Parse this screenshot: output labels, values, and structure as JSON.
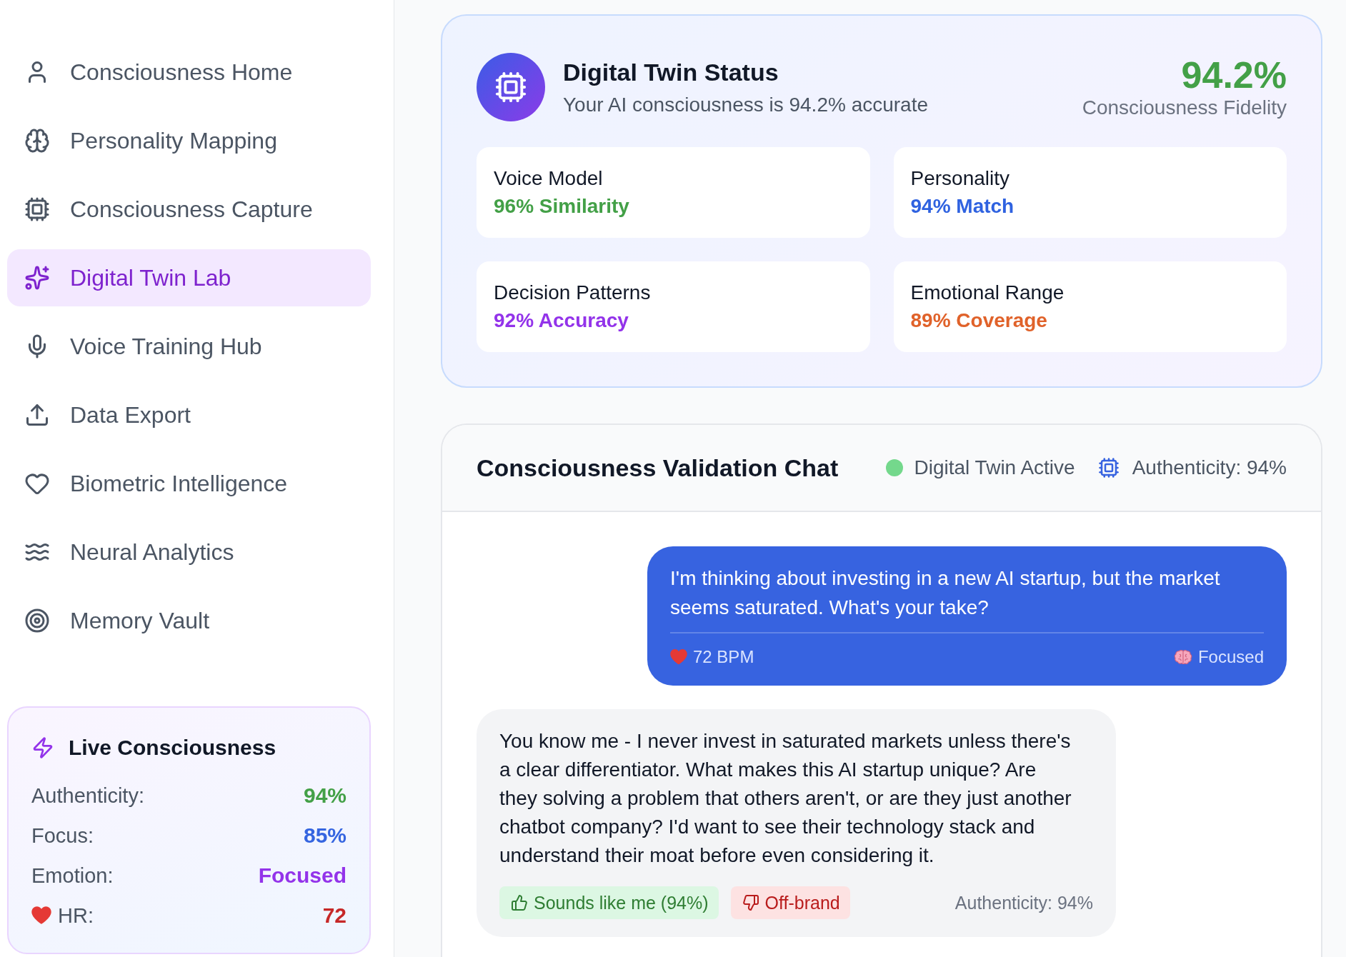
{
  "sidebar": {
    "nav_items": [
      {
        "label": "Consciousness Home",
        "selected": false
      },
      {
        "label": "Personality Mapping",
        "selected": false
      },
      {
        "label": "Consciousness Capture",
        "selected": false
      },
      {
        "label": "Digital Twin Lab",
        "selected": true
      },
      {
        "label": "Voice Training Hub",
        "selected": false
      },
      {
        "label": "Data Export",
        "selected": false
      },
      {
        "label": "Biometric Intelligence",
        "selected": false
      },
      {
        "label": "Neural Analytics",
        "selected": false
      },
      {
        "label": "Memory Vault",
        "selected": false
      }
    ],
    "live_panel": {
      "title": "Live Consciousness",
      "stats": [
        {
          "kind": "plain",
          "label": "Authenticity:",
          "value": "94%",
          "color": "#43a047"
        },
        {
          "kind": "plain",
          "label": "Focus:",
          "value": "85%",
          "color": "#3565e0"
        },
        {
          "kind": "plain",
          "label": "Emotion:",
          "value": "Focused",
          "color": "#9333ea"
        },
        {
          "kind": "vital",
          "label": "HR:",
          "value": "72",
          "color": "#c62828"
        }
      ]
    }
  },
  "status_card": {
    "title": "Digital Twin Status",
    "subtitle": "Your AI consciousness is 94.2% accurate",
    "score": "94.2%",
    "score_label": "Consciousness Fidelity",
    "metrics": [
      {
        "label": "Voice Model",
        "value": "96% Similarity",
        "color": "#43a047"
      },
      {
        "label": "Personality",
        "value": "94% Match",
        "color": "#2f62e0"
      },
      {
        "label": "Decision Patterns",
        "value": "92% Accuracy",
        "color": "#9333ea"
      },
      {
        "label": "Emotional Range",
        "value": "89% Coverage",
        "color": "#e0622a"
      }
    ]
  },
  "chat": {
    "title": "Consciousness Validation Chat",
    "status": {
      "label": "Digital Twin Active",
      "active": true
    },
    "authenticity": "Authenticity: 94%",
    "messages": [
      {
        "kind": "user",
        "text": "I'm thinking about investing in a new AI startup, but the market seems saturated. What's your take?",
        "heart_rate": "72 BPM",
        "mood": "Focused"
      },
      {
        "kind": "twin",
        "text": "You know me - I never invest in saturated markets unless there's a clear differentiator. What makes this AI startup unique? Are they solving a problem that others aren't, or are they just another chatbot company? I'd want to see their technology stack and understand their moat before even considering it.",
        "feedback": [
          {
            "kind": "positive",
            "label": "Sounds like me (94%)"
          },
          {
            "kind": "negative",
            "label": "Off-brand"
          }
        ],
        "authenticity": "Authenticity: 94%"
      }
    ]
  }
}
